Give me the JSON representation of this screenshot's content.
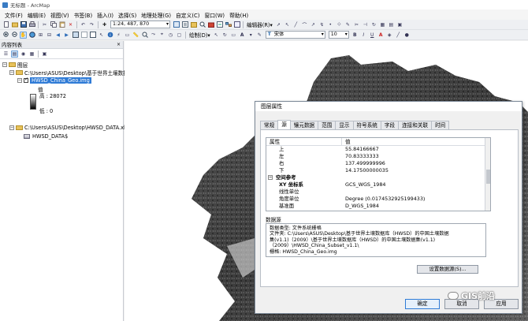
{
  "window": {
    "title": "无标题 - ArcMap"
  },
  "menu": [
    "文件(F)",
    "编辑(E)",
    "视图(V)",
    "书签(B)",
    "插入(I)",
    "选择(S)",
    "地理处理(G)",
    "自定义(C)",
    "窗口(W)",
    "帮助(H)"
  ],
  "toolbar": {
    "scale": "1:24, 487, 870",
    "editor_label": "编辑器(R)▾",
    "draw_label": "绘制(D)▾",
    "font_name": "宋体",
    "font_size": "10",
    "bold": "B",
    "italic": "I",
    "underline": "U",
    "text_tool": "A"
  },
  "toc": {
    "title": "内容列表",
    "close": "×",
    "layers_root": "图层",
    "folder1": "C:\\Users\\ASUS\\Desktop\\基于世界土壤数据",
    "layer": "HWSD_China_Geo.img",
    "value_label": "值",
    "high": "高 : 28072",
    "low": "低 : 0",
    "folder2": "C:\\Users\\ASUS\\Desktop\\HWSD_DATA.xlsx",
    "table": "HWSD_DATA$"
  },
  "dialog": {
    "title": "图层属性",
    "tabs": [
      "常规",
      "源",
      "镶元数据",
      "范围",
      "显示",
      "符号系统",
      "字段",
      "连接和关联",
      "时间"
    ],
    "active_tab": 1,
    "props_header": {
      "property": "属性",
      "value": "值"
    },
    "rows": [
      {
        "k": "上",
        "v": "55.84166667",
        "type": "item"
      },
      {
        "k": "左",
        "v": "70.83333333",
        "type": "item"
      },
      {
        "k": "右",
        "v": "137.499999996",
        "type": "item"
      },
      {
        "k": "下",
        "v": "14.17500000035",
        "type": "item"
      },
      {
        "k": "空间参考",
        "v": "",
        "type": "section"
      },
      {
        "k": "XY 坐标系",
        "v": "GCS_WGS_1984",
        "type": "bold"
      },
      {
        "k": "线性单位",
        "v": "",
        "type": "item"
      },
      {
        "k": "角度单位",
        "v": "Degree (0.0174532925199433)",
        "type": "item"
      },
      {
        "k": "基准面",
        "v": "D_WGS_1984",
        "type": "item"
      }
    ],
    "datasource_label": "数据源",
    "datasource_lines": [
      "数据类型:               文件系统栅格",
      "文件夹:          C:\\Users\\ASUS\\Desktop\\基于世界土壤数据库（HWSD）的中国土壤数据",
      "集(v1.1)（2009）\\基于世界土壤数据库（HWSD）的中国土壤数据集(v1.1)",
      "（2009）\\HWSD_China_Subset_v1.1\\",
      "栅格:                     HWSD_China_Geo.img"
    ],
    "set_source_button": "设置数据源(S)...",
    "ok": "确定",
    "cancel": "取消",
    "apply": "应用"
  },
  "watermark": "GIS前沿",
  "colors": {
    "selection": "#2f7bd6",
    "folder": "#e8c25a"
  }
}
